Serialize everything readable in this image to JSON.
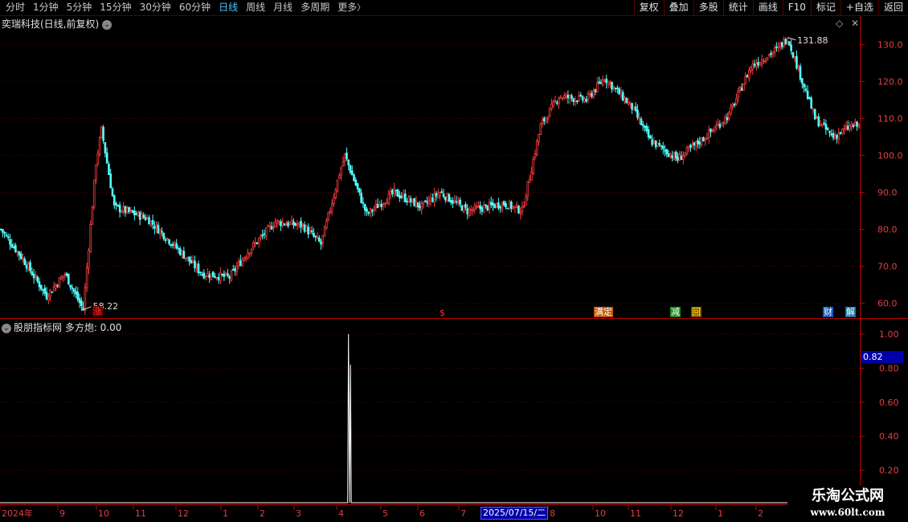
{
  "toolbar": {
    "periods": [
      "分时",
      "1分钟",
      "5分钟",
      "15分钟",
      "30分钟",
      "60分钟",
      "日线",
      "周线",
      "月线",
      "多周期",
      "更多"
    ],
    "active_period": "日线",
    "more_arrow": "〉",
    "tools": [
      "复权",
      "叠加",
      "多股",
      "统计",
      "画线",
      "F10",
      "标记",
      "+自选",
      "返回"
    ]
  },
  "main_panel": {
    "title": "奕瑞科技(日线,前复权)",
    "high_label": "131.88",
    "low_label": "58.22",
    "price_axis": [
      "130.0",
      "120.0",
      "110.0",
      "100.0",
      "90.0",
      "80.0",
      "70.0",
      "60.0"
    ],
    "badges": [
      {
        "text": "涨",
        "color": "#ff3030",
        "bg": "#600000"
      },
      {
        "text": "$",
        "color": "#ff3030",
        "bg": "#000000"
      },
      {
        "text": "满定",
        "color": "#ffffff",
        "bg": "#c05a00"
      },
      {
        "text": "减",
        "color": "#ffffff",
        "bg": "#1c8a1c"
      },
      {
        "text": "回",
        "color": "#ffff00",
        "bg": "#805000"
      },
      {
        "text": "财",
        "color": "#ffffff",
        "bg": "#1058c0"
      },
      {
        "text": "解",
        "color": "#ffffff",
        "bg": "#1078a0"
      }
    ]
  },
  "indicator_panel": {
    "title": "股朋指标网 多方炮: 0.00",
    "axis": [
      "1.00",
      "0.80",
      "0.60",
      "0.40",
      "0.20"
    ],
    "highlight_value": "0.82"
  },
  "date_axis": {
    "labels": [
      "2024年",
      "9",
      "10",
      "11",
      "12",
      "1",
      "2",
      "3",
      "4",
      "5",
      "6",
      "7",
      "8",
      "10",
      "11",
      "12",
      "1",
      "2"
    ],
    "highlight": "2025/07/15/二"
  },
  "watermark": {
    "title": "乐淘公式网",
    "url": "www.60lt.com"
  },
  "colors": {
    "up": "#ff3c3c",
    "down": "#54ffff",
    "grid": "#600000",
    "axis": "#c00000"
  },
  "chart_data": {
    "type": "candlestick",
    "title": "奕瑞科技(日线,前复权)",
    "ylim": [
      56,
      134
    ],
    "anchors": [
      [
        0,
        80
      ],
      [
        12,
        72
      ],
      [
        25,
        62
      ],
      [
        35,
        68
      ],
      [
        45,
        58.22
      ],
      [
        52,
        98
      ],
      [
        55,
        107
      ],
      [
        62,
        86
      ],
      [
        80,
        83
      ],
      [
        90,
        78
      ],
      [
        110,
        68
      ],
      [
        125,
        67
      ],
      [
        135,
        74
      ],
      [
        150,
        82
      ],
      [
        165,
        81
      ],
      [
        175,
        76
      ],
      [
        185,
        95
      ],
      [
        188,
        100
      ],
      [
        200,
        84
      ],
      [
        215,
        90
      ],
      [
        230,
        86
      ],
      [
        240,
        90
      ],
      [
        255,
        85
      ],
      [
        275,
        87
      ],
      [
        285,
        85
      ],
      [
        295,
        108
      ],
      [
        305,
        116
      ],
      [
        320,
        115
      ],
      [
        330,
        121
      ],
      [
        345,
        113
      ],
      [
        355,
        104
      ],
      [
        370,
        99
      ],
      [
        385,
        105
      ],
      [
        398,
        111
      ],
      [
        410,
        124
      ],
      [
        425,
        129
      ],
      [
        430,
        131.88
      ],
      [
        445,
        110
      ],
      [
        455,
        105
      ],
      [
        465,
        108
      ]
    ],
    "indicator": {
      "name": "多方炮",
      "ylim": [
        0,
        1.0
      ],
      "spike_index": 190,
      "spike_values": [
        1.0,
        0.82
      ]
    }
  }
}
